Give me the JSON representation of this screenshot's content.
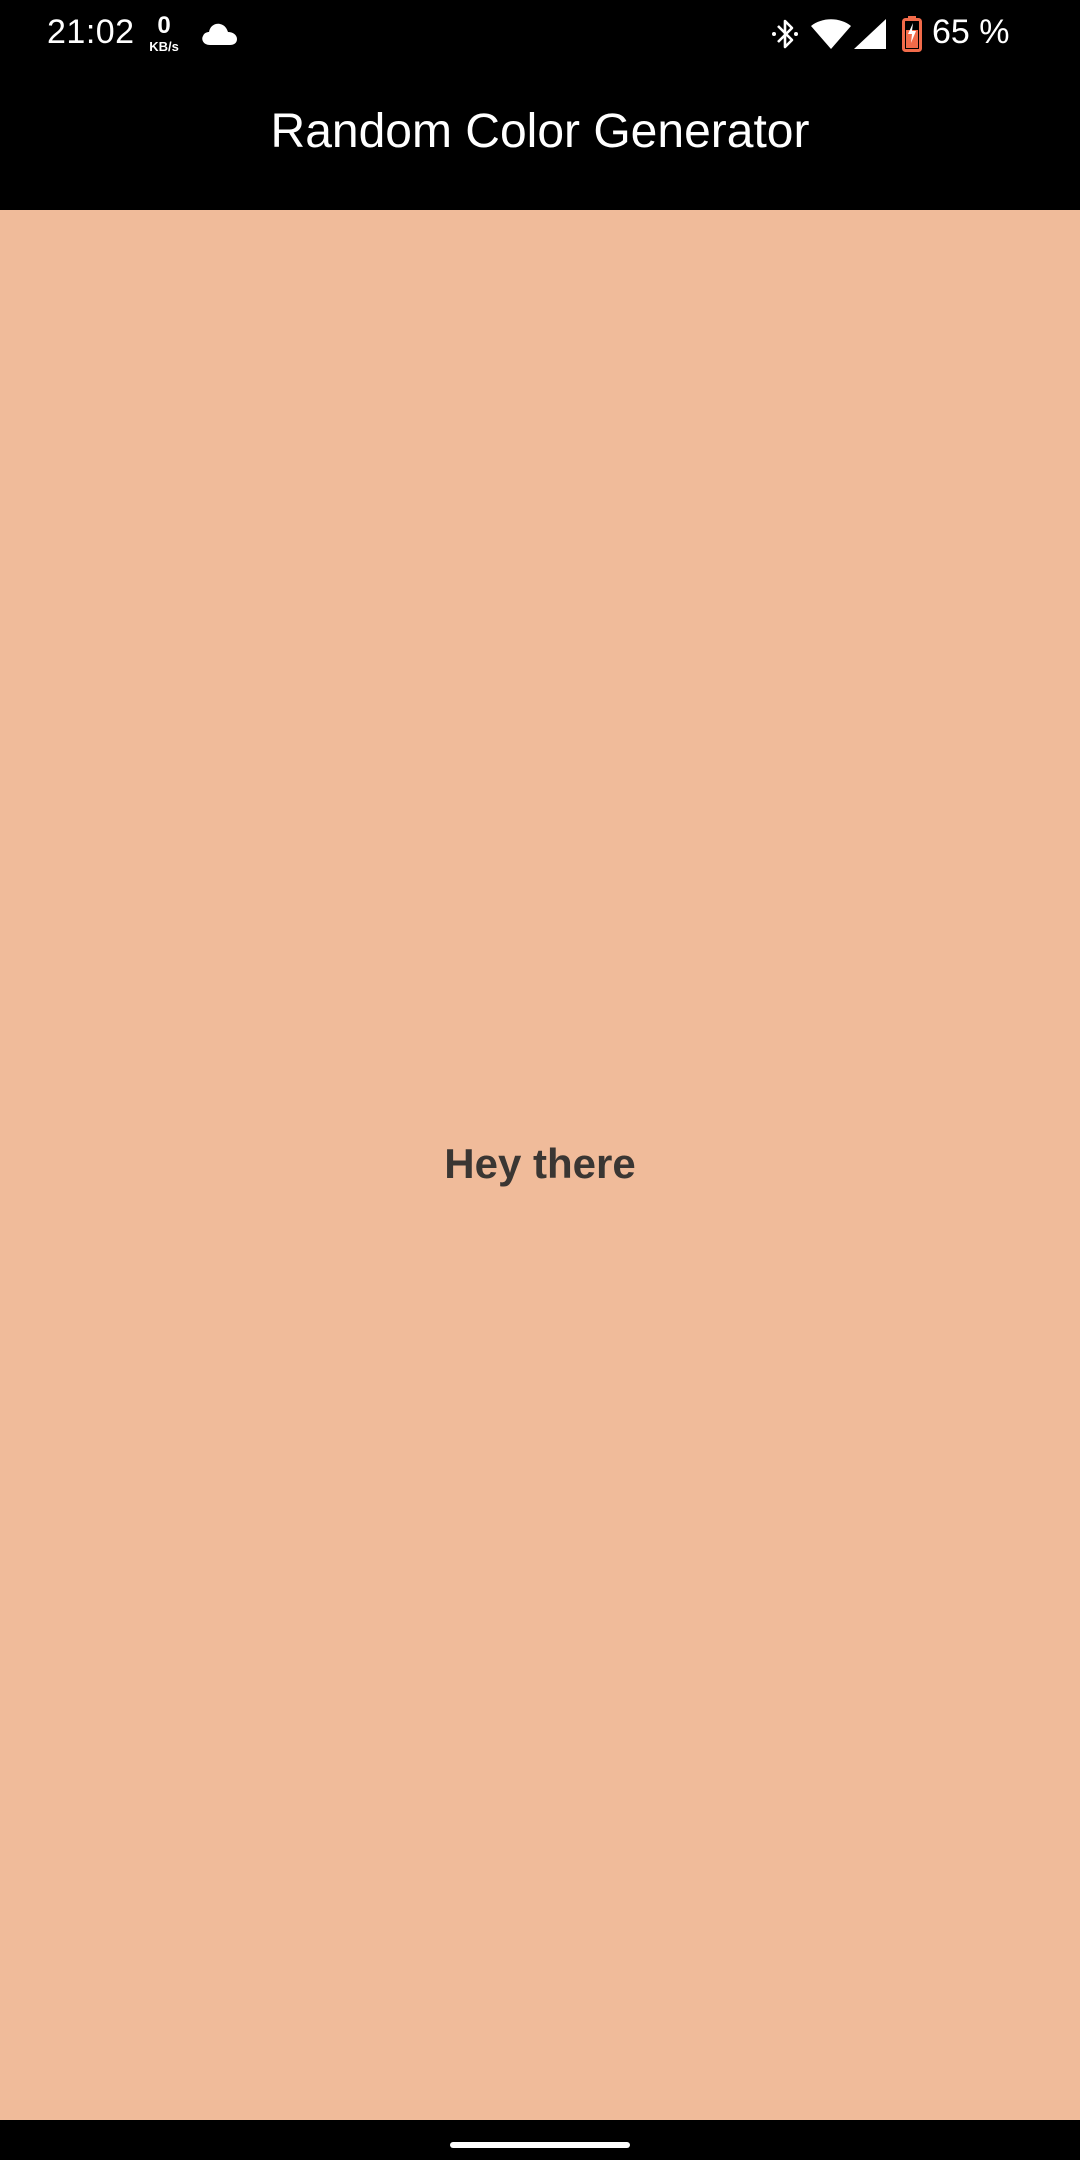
{
  "status_bar": {
    "time": "21:02",
    "net_speed_value": "0",
    "net_speed_unit": "KB/s",
    "battery_percent": "65 %",
    "icons": [
      "cloud-icon",
      "bluetooth-icon",
      "wifi-icon",
      "cellular-signal-icon",
      "battery-charging-icon"
    ],
    "battery_color": "#f26b4a"
  },
  "app_bar": {
    "title": "Random Color Generator"
  },
  "main": {
    "greeting": "Hey there",
    "background_color": "#f0bb9a"
  }
}
